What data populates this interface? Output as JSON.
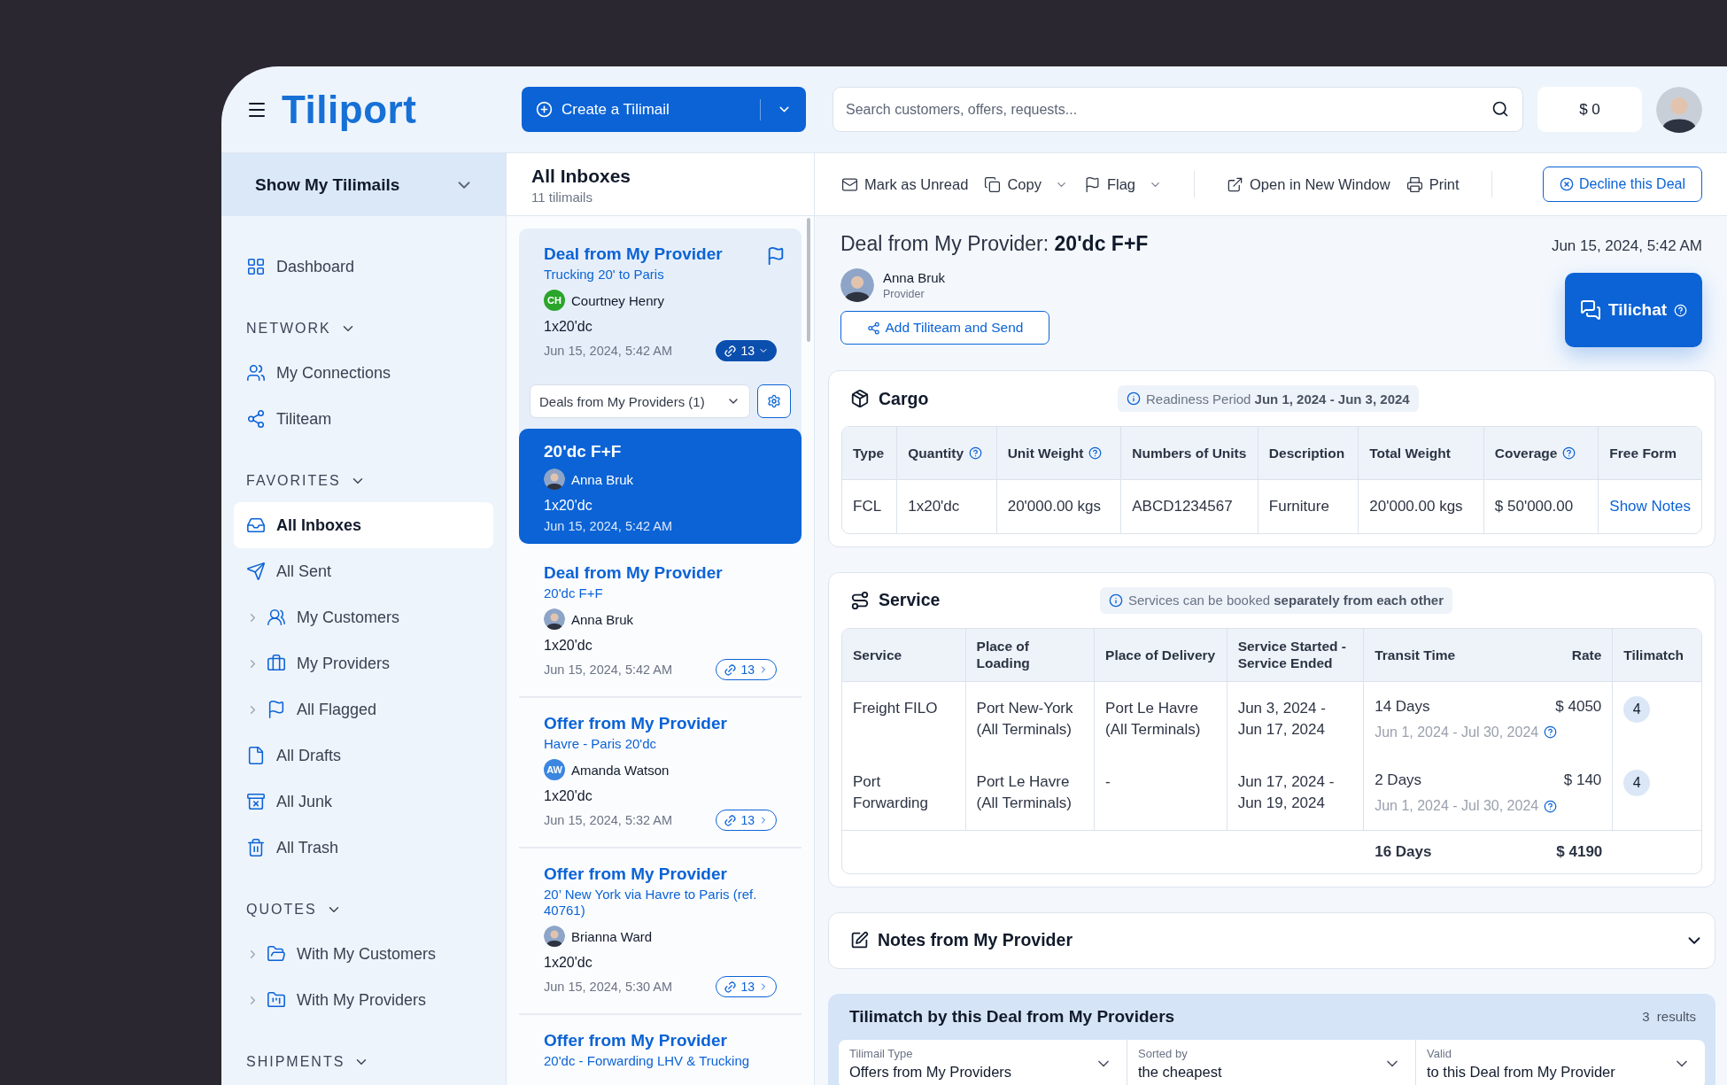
{
  "header": {
    "logo": "Tiliport",
    "create_button": "Create a Tilimail",
    "search": {
      "placeholder": "Search customers, offers, requests..."
    },
    "balance": "$ 0"
  },
  "sidebar": {
    "filter": "Show My Tilimails",
    "sections": [
      {
        "items": [
          {
            "label": "Dashboard",
            "expandable": false,
            "selected": false
          }
        ]
      },
      {
        "title": "NETWORK",
        "items": [
          {
            "label": "My Connections",
            "expandable": false,
            "selected": false
          },
          {
            "label": "Tiliteam",
            "expandable": false,
            "selected": false
          }
        ]
      },
      {
        "title": "FAVORITES",
        "items": [
          {
            "label": "All Inboxes",
            "expandable": false,
            "selected": true
          },
          {
            "label": "All Sent",
            "expandable": false,
            "selected": false
          },
          {
            "label": "My Customers",
            "expandable": true,
            "selected": false
          },
          {
            "label": "My Providers",
            "expandable": true,
            "selected": false
          },
          {
            "label": "All Flagged",
            "expandable": true,
            "selected": false
          },
          {
            "label": "All Drafts",
            "expandable": false,
            "selected": false
          },
          {
            "label": "All Junk",
            "expandable": false,
            "selected": false
          },
          {
            "label": "All Trash",
            "expandable": false,
            "selected": false
          }
        ]
      },
      {
        "title": "QUOTES",
        "items": [
          {
            "label": "With My Customers",
            "expandable": true,
            "selected": false
          },
          {
            "label": "With My Providers",
            "expandable": true,
            "selected": false
          }
        ]
      },
      {
        "title": "SHIPMENTS"
      }
    ]
  },
  "inbox": {
    "title": "All Inboxes",
    "count": "11 tilimails",
    "items": [
      {
        "title": "Deal from My Provider",
        "subtitle": "Trucking 20' to Paris",
        "sender": {
          "name": "Courtney Henry",
          "kind": "initials",
          "initials": "CH",
          "color": "#2aa52a"
        },
        "quantity": "1x20'dc",
        "date": "Jun 15, 2024, 5:42 AM",
        "links": "13",
        "flagged": true,
        "expanded": true,
        "selected": false,
        "group": {
          "filter": "Deals from My Providers (1)",
          "items": [
            {
              "title": "20'dc F+F",
              "sender": {
                "name": "Anna Bruk",
                "kind": "photo"
              },
              "quantity": "1x20'dc",
              "date": "Jun 15, 2024, 5:42 AM",
              "selected": true
            }
          ]
        }
      },
      {
        "title": "Deal from My Provider",
        "subtitle": "20'dc F+F",
        "sender": {
          "name": "Anna Bruk",
          "kind": "photo"
        },
        "quantity": "1x20'dc",
        "date": "Jun 15, 2024, 5:42 AM",
        "links": "13",
        "flagged": false,
        "expanded": false,
        "selected": false
      },
      {
        "title": "Offer from My Provider",
        "subtitle": "Havre - Paris 20'dc",
        "sender": {
          "name": "Amanda Watson",
          "kind": "initials",
          "initials": "AW",
          "color": "#3b86e0"
        },
        "quantity": "1x20'dc",
        "date": "Jun 15, 2024, 5:32 AM",
        "links": "13",
        "flagged": false,
        "expanded": false,
        "selected": false
      },
      {
        "title": "Offer from My Provider",
        "subtitle": "20’ New York via Havre to Paris (ref. 40761)",
        "sender": {
          "name": "Brianna Ward",
          "kind": "photo"
        },
        "quantity": "1x20'dc",
        "date": "Jun 15, 2024, 5:30 AM",
        "links": "13",
        "flagged": false,
        "expanded": false,
        "selected": false
      },
      {
        "title": "Offer from My Provider",
        "subtitle": "20'dc - Forwarding LHV & Trucking",
        "flagged": false,
        "selected": false
      }
    ]
  },
  "toolbar": {
    "groups": [
      [
        {
          "label": "Mark as Unread",
          "dropdown": false
        },
        {
          "label": "Copy",
          "dropdown": true
        },
        {
          "label": "Flag",
          "dropdown": true
        }
      ],
      [
        {
          "label": "Open in New Window",
          "dropdown": false
        },
        {
          "label": "Print",
          "dropdown": false
        }
      ]
    ],
    "decline": "Decline this Deal"
  },
  "deal": {
    "title": "Deal from My Provider: **20'dc F+F**",
    "date": "Jun 15, 2024, 5:42 AM",
    "sender": {
      "name": "Anna Bruk",
      "role": "Provider"
    },
    "add_button": "Add Tiliteam and Send",
    "chat_button": "Tilichat"
  },
  "cargo": {
    "title": "Cargo",
    "note": "Readiness Period **Jun 1, 2024 - Jun 3, 2024**",
    "columns": [
      {
        "label": "Type",
        "kind": "text"
      },
      {
        "label": "Quantity",
        "help": true,
        "kind": "text"
      },
      {
        "label": "Unit Weight",
        "help": true,
        "kind": "text"
      },
      {
        "label": "Numbers of Units",
        "kind": "text"
      },
      {
        "label": "Description",
        "kind": "text"
      },
      {
        "label": "Total Weight",
        "kind": "text"
      },
      {
        "label": "Coverage",
        "help": true,
        "kind": "text"
      },
      {
        "label": "Free Form",
        "kind": "link"
      }
    ],
    "rows": [
      [
        "FCL",
        "1x20'dc",
        "20'000.00 kgs",
        "ABCD1234567",
        "Furniture",
        "20'000.00 kgs",
        "$ 50'000.00",
        "Show Notes"
      ]
    ]
  },
  "service": {
    "title": "Service",
    "note": "Services can be booked **separately from each other**",
    "columns": [
      "Service",
      "Place of Loading",
      "Place of Delivery",
      "Service Started - Service Ended",
      "Transit Time",
      "Rate",
      "Tilimatch"
    ],
    "rows": [
      {
        "service": "Freight FILO",
        "loading": "Port New-York (All Terminals)",
        "delivery": "Port Le Havre (All Terminals)",
        "period": "Jun 3, 2024 - Jun 17, 2024",
        "transit": "14 Days",
        "rate": "$ 4050",
        "validity": "Jun 1, 2024 - Jul 30, 2024",
        "tilimatch": "4"
      },
      {
        "service": "Port Forwarding",
        "loading": "Port Le Havre (All Terminals)",
        "delivery": "-",
        "period": "Jun 17, 2024 - Jun 19, 2024",
        "transit": "2 Days",
        "rate": "$ 140",
        "validity": "Jun 1, 2024 - Jul 30, 2024",
        "tilimatch": "4"
      }
    ],
    "total": {
      "transit": "16 Days",
      "rate": "$ 4190"
    }
  },
  "notes": {
    "title": "Notes from My Provider",
    "expanded": false
  },
  "tilimatch": {
    "title": "Tilimatch by this Deal from My Providers",
    "count": "3",
    "count_label": "results",
    "filters": [
      {
        "label": "Tilimail Type",
        "value": "Offers from My Providers"
      },
      {
        "label": "Sorted by",
        "value": "the cheapest"
      },
      {
        "label": "Valid",
        "value": "to this Deal from My Provider"
      }
    ]
  }
}
